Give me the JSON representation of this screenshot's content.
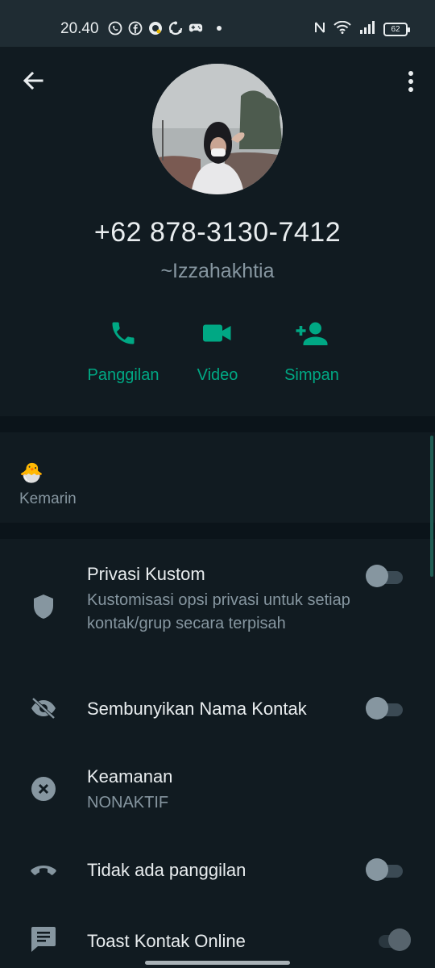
{
  "status_bar": {
    "time": "20.40",
    "battery": "62",
    "app_icons": [
      "whatsapp-icon",
      "facebook-icon",
      "app-icon",
      "sync-icon",
      "gamepad-icon"
    ],
    "system_icons": [
      "nfc-icon",
      "wifi-icon",
      "signal-icon",
      "battery-icon"
    ]
  },
  "header": {
    "phone_number": "+62 878-3130-7412",
    "push_name": "~Izzahakhtia",
    "actions": [
      {
        "label": "Panggilan",
        "icon": "phone-icon"
      },
      {
        "label": "Video",
        "icon": "video-icon"
      },
      {
        "label": "Simpan",
        "icon": "add-person-icon"
      }
    ]
  },
  "about": {
    "emoji": "🐣",
    "date": "Kemarin"
  },
  "settings": [
    {
      "title": "Privasi Kustom",
      "subtitle": "Kustomisasi opsi privasi untuk setiap kontak/grup secara terpisah",
      "icon": "shield-icon",
      "toggle": false
    },
    {
      "title": "Sembunyikan Nama Kontak",
      "icon": "eye-off-icon",
      "toggle": false
    },
    {
      "title": "Keamanan",
      "subtitle": "NONAKTIF",
      "icon": "close-circle-icon"
    },
    {
      "title": "Tidak ada panggilan",
      "icon": "call-end-icon",
      "toggle": false
    },
    {
      "title": "Toast Kontak Online",
      "icon": "message-icon",
      "toggle": false
    }
  ],
  "colors": {
    "accent": "#00a884",
    "background": "#0b141a",
    "card": "#111b21",
    "text_primary": "#e9edef",
    "text_secondary": "#8696a0"
  }
}
